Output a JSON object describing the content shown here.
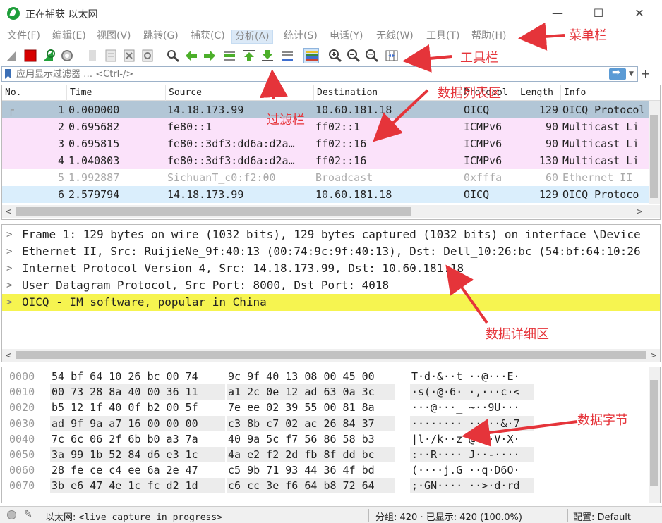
{
  "window": {
    "title": "正在捕获 以太网",
    "minimize": "—",
    "maximize": "☐",
    "close": "✕"
  },
  "menu": [
    {
      "label": "文件(F)"
    },
    {
      "label": "编辑(E)"
    },
    {
      "label": "视图(V)"
    },
    {
      "label": "跳转(G)"
    },
    {
      "label": "捕获(C)"
    },
    {
      "label": "分析(A)"
    },
    {
      "label": "统计(S)"
    },
    {
      "label": "电话(Y)"
    },
    {
      "label": "无线(W)"
    },
    {
      "label": "工具(T)"
    },
    {
      "label": "帮助(H)"
    }
  ],
  "toolbar_icons": [
    "shark-fin-icon",
    "stop-icon",
    "restart-icon",
    "options-gear-icon",
    "open-file-icon",
    "save-file-icon",
    "close-file-icon",
    "reload-icon",
    "find-icon",
    "back-icon",
    "forward-icon",
    "go-to-packet-icon",
    "first-packet-icon",
    "last-packet-icon",
    "autoscroll-icon",
    "colorize-icon",
    "zoom-in-icon",
    "zoom-out-icon",
    "zoom-reset-icon",
    "resize-columns-icon"
  ],
  "filter": {
    "placeholder": "应用显示过滤器 … <Ctrl-/>"
  },
  "packet_list": {
    "columns": [
      "No.",
      "Time",
      "Source",
      "Destination",
      "Protocol",
      "Length",
      "Info"
    ],
    "rows": [
      {
        "no": "1",
        "time": "0.000000",
        "source": "14.18.173.99",
        "destination": "10.60.181.18",
        "protocol": "OICQ",
        "length": "129",
        "info": "OICQ Protocol",
        "bg": "#b2c6d6",
        "fg": "#222222"
      },
      {
        "no": "2",
        "time": "0.695682",
        "source": "fe80::1",
        "destination": "ff02::1",
        "protocol": "ICMPv6",
        "length": "90",
        "info": "Multicast Li",
        "bg": "#fbe2fa",
        "fg": "#222222"
      },
      {
        "no": "3",
        "time": "0.695815",
        "source": "fe80::3df3:dd6a:d2a…",
        "destination": "ff02::16",
        "protocol": "ICMPv6",
        "length": "90",
        "info": "Multicast Li",
        "bg": "#fbe2fa",
        "fg": "#222222"
      },
      {
        "no": "4",
        "time": "1.040803",
        "source": "fe80::3df3:dd6a:d2a…",
        "destination": "ff02::16",
        "protocol": "ICMPv6",
        "length": "130",
        "info": "Multicast Li",
        "bg": "#fbe2fa",
        "fg": "#222222"
      },
      {
        "no": "5",
        "time": "1.992887",
        "source": "SichuanT_c0:f2:00",
        "destination": "Broadcast",
        "protocol": "0xfffa",
        "length": "60",
        "info": "Ethernet II",
        "bg": "#ffffff",
        "fg": "#aaaaaa"
      },
      {
        "no": "6",
        "time": "2.579794",
        "source": "14.18.173.99",
        "destination": "10.60.181.18",
        "protocol": "OICQ",
        "length": "129",
        "info": "OICQ Protoco",
        "bg": "#daeefc",
        "fg": "#222222"
      }
    ]
  },
  "details": [
    {
      "text": "Frame 1: 129 bytes on wire (1032 bits), 129 bytes captured (1032 bits) on interface \\Device",
      "bg": "#ffffff"
    },
    {
      "text": "Ethernet II, Src: RuijieNe_9f:40:13 (00:74:9c:9f:40:13), Dst: Dell_10:26:bc (54:bf:64:10:26",
      "bg": "#ffffff"
    },
    {
      "text": "Internet Protocol Version 4, Src: 14.18.173.99, Dst: 10.60.181.18",
      "bg": "#ffffff"
    },
    {
      "text": "User Datagram Protocol, Src Port: 8000, Dst Port: 4018",
      "bg": "#ffffff"
    },
    {
      "text": "OICQ - IM software, popular in China",
      "bg": "#f6f450"
    }
  ],
  "bytes": [
    {
      "offset": "0000",
      "hex1": "54 bf 64 10 26 bc 00 74",
      "hex2": "9c 9f 40 13 08 00 45 00",
      "ascii": "T·d·&··t ··@···E·"
    },
    {
      "offset": "0010",
      "hex1": "00 73 28 8a 40 00 36 11",
      "hex2": "a1 2c 0e 12 ad 63 0a 3c",
      "ascii": "·s(·@·6· ·,···c·<"
    },
    {
      "offset": "0020",
      "hex1": "b5 12 1f 40 0f b2 00 5f",
      "hex2": "7e ee 02 39 55 00 81 8a",
      "ascii": "···@···_ ~··9U···"
    },
    {
      "offset": "0030",
      "hex1": "ad 9f 9a a7 16 00 00 00",
      "hex2": "c3 8b c7 02 ac 26 84 37",
      "ascii": "········ ·····&·7"
    },
    {
      "offset": "0040",
      "hex1": "7c 6c 06 2f 6b b0 a3 7a",
      "hex2": "40 9a 5c f7 56 86 58 b3",
      "ascii": "|l·/k··z @·\\·V·X·"
    },
    {
      "offset": "0050",
      "hex1": "3a 99 1b 52 84 d6 e3 1c",
      "hex2": "4a e2 f2 2d fb 8f dd bc",
      "ascii": ":··R···· J··-····"
    },
    {
      "offset": "0060",
      "hex1": "28 fe ce c4 ee 6a 2e 47",
      "hex2": "c5 9b 71 93 44 36 4f bd",
      "ascii": "(····j.G ··q·D6O·"
    },
    {
      "offset": "0070",
      "hex1": "3b e6 47 4e 1c fc d2 1d",
      "hex2": "c6 cc 3e f6 64 b8 72 64",
      "ascii": ";·GN···· ··>·d·rd"
    }
  ],
  "status": {
    "interface_label": "以太网: ",
    "interface_state": "<live capture in progress>",
    "stats": "分组: 420 · 已显示: 420 (100.0%)",
    "profile": "配置: Default"
  },
  "annotations": {
    "menubar": "菜单栏",
    "toolbar": "工具栏",
    "packet_list": "数据列表区",
    "filter": "过滤栏",
    "details": "数据详细区",
    "bytes": "数据字节"
  }
}
